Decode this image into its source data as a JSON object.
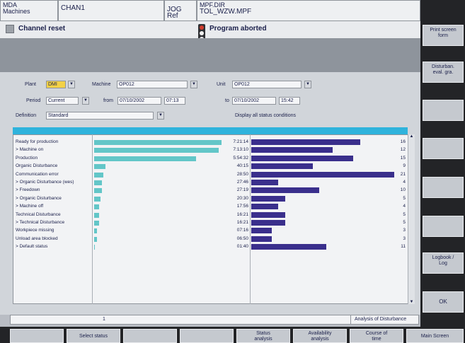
{
  "header": {
    "area": "MDA\nMachines",
    "channel": "CHAN1",
    "mode": "JOG Ref",
    "program_path": "MPF.DIR",
    "program_file": "TOL_WZW.MPF"
  },
  "alarm": {
    "message": "Channel reset",
    "program_state": "Program aborted"
  },
  "filters": {
    "plant_label": "Plant",
    "plant_value": "DMI",
    "machine_label": "Machine",
    "machine_value": "OP012",
    "unit_label": "Unit",
    "unit_value": "OP012",
    "period_label": "Period",
    "period_value": "Current",
    "from_label": "from",
    "from_date": "07/10/2002",
    "from_time": "07:13",
    "to_label": "to",
    "to_date": "07/10/2002",
    "to_time": "15:42",
    "definition_label": "Definition",
    "definition_value": "Standard",
    "display_all": "Display all status conditions"
  },
  "table": {
    "rows": [
      {
        "label": "Ready for production",
        "duration": "7:21:14",
        "count": 16
      },
      {
        "label": "> Machine on",
        "duration": "7:13:10",
        "count": 12
      },
      {
        "label": "Production",
        "duration": "5:54:32",
        "count": 15
      },
      {
        "label": "Organic Disturbance",
        "duration": "40:15",
        "count": 9
      },
      {
        "label": "Communication error",
        "duration": "28:50",
        "count": 21
      },
      {
        "label": "> Organic Disturbance (wes)",
        "duration": "27:46",
        "count": 4
      },
      {
        "label": "> Freedown",
        "duration": "27:19",
        "count": 10
      },
      {
        "label": "> Organic Disturbance",
        "duration": "20:30",
        "count": 5
      },
      {
        "label": "> Machine off",
        "duration": "17:56",
        "count": 4
      },
      {
        "label": "Technical Disturbance",
        "duration": "16:21",
        "count": 5
      },
      {
        "label": "> Technical Disturbance",
        "duration": "16:21",
        "count": 5
      },
      {
        "label": "Workpiece missing",
        "duration": "07:16",
        "count": 3
      },
      {
        "label": "Unload area blocked",
        "duration": "06:50",
        "count": 3
      },
      {
        "label": "> Default status",
        "duration": "01:40",
        "count": 11
      }
    ],
    "duration_fractions": [
      1.0,
      0.98,
      0.8,
      0.09,
      0.07,
      0.06,
      0.06,
      0.05,
      0.04,
      0.04,
      0.04,
      0.02,
      0.02,
      0.005
    ],
    "max_count": 21
  },
  "status_bar": {
    "page_indicator": "1",
    "right_text": "Analysis of Disturbance"
  },
  "right_softkeys": {
    "print": "Print screen\nform",
    "disturbance": "Disturban.\neval. gra.",
    "logbook": "Logbook /\nLog",
    "ok": "OK"
  },
  "bottom_softkeys": {
    "select_status": "Select status",
    "status_analysis": "Status\nanalysis",
    "availability_analysis": "Availability\nanalysis",
    "course_of_time": "Course of\ntime",
    "main_screen": "Main Screen"
  },
  "colors": {
    "table_header": "#2fb3dc",
    "time_bar": "#63c6c8",
    "count_bar": "#3a2f8c"
  }
}
